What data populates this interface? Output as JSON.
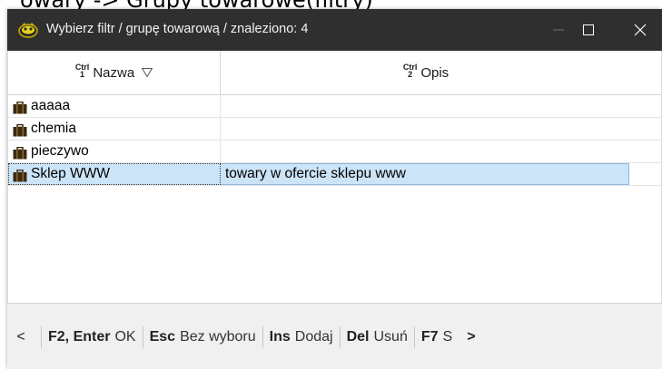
{
  "background": {
    "partial_text": "owary -> Grupy towarowe(filtry)"
  },
  "window": {
    "title": "Wybierz filtr / grupę towarową / znaleziono: 4",
    "buttons": {
      "minimize": "—",
      "maximize": "□",
      "close": "✕"
    }
  },
  "table": {
    "columns": [
      {
        "hint_top": "Ctrl",
        "hint_num": "1",
        "label": "Nazwa",
        "sorted": true
      },
      {
        "hint_top": "Ctrl",
        "hint_num": "2",
        "label": "Opis"
      }
    ],
    "rows": [
      {
        "name": "aaaaa",
        "desc": ""
      },
      {
        "name": "chemia",
        "desc": ""
      },
      {
        "name": "pieczywo",
        "desc": ""
      },
      {
        "name": "Sklep WWW",
        "desc": "towary w ofercie sklepu www",
        "selected": true
      }
    ]
  },
  "footer": {
    "items": [
      {
        "key": "F2, Enter",
        "label": "OK"
      },
      {
        "key": "Esc",
        "label": "Bez wyboru"
      },
      {
        "key": "Ins",
        "label": "Dodaj"
      },
      {
        "key": "Del",
        "label": "Usuń"
      },
      {
        "key": "F7",
        "label": "S"
      }
    ],
    "nav_left": "<",
    "nav_right": ">"
  },
  "colors": {
    "titlebar": "#2f2f2f",
    "selection": "#cce4f7",
    "footer": "#f0f0f0"
  }
}
